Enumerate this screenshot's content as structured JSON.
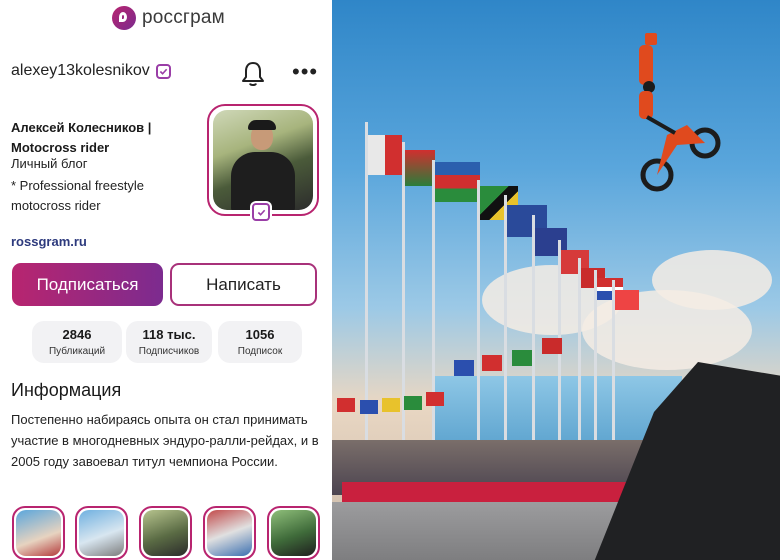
{
  "app": {
    "brand_name": "россграм",
    "accent": "#b8246f"
  },
  "profile": {
    "username": "alexey13kolesnikov",
    "display_name": "Алексей Колесников | Motocross rider",
    "bio_line1": "Личный блог",
    "bio_line2": "* Professional freestyle motocross rider",
    "link": "rossgram.ru"
  },
  "actions": {
    "follow": "Подписаться",
    "message": "Написать"
  },
  "stats": [
    {
      "value": "2846",
      "label": "Публикаций"
    },
    {
      "value": "118 тыс.",
      "label": "Подписчиков"
    },
    {
      "value": "1056",
      "label": "Подписок"
    }
  ],
  "info": {
    "title": "Информация",
    "text": "Постепенно набираясь опыта он стал принимать участие в многодневных эндуро-ралли-рейдах, и в 2005 году завоевал титул чемпиона России."
  },
  "icons": {
    "bell": "bell-icon",
    "more": "more-dots-icon",
    "verified": "verified-badge-icon"
  }
}
